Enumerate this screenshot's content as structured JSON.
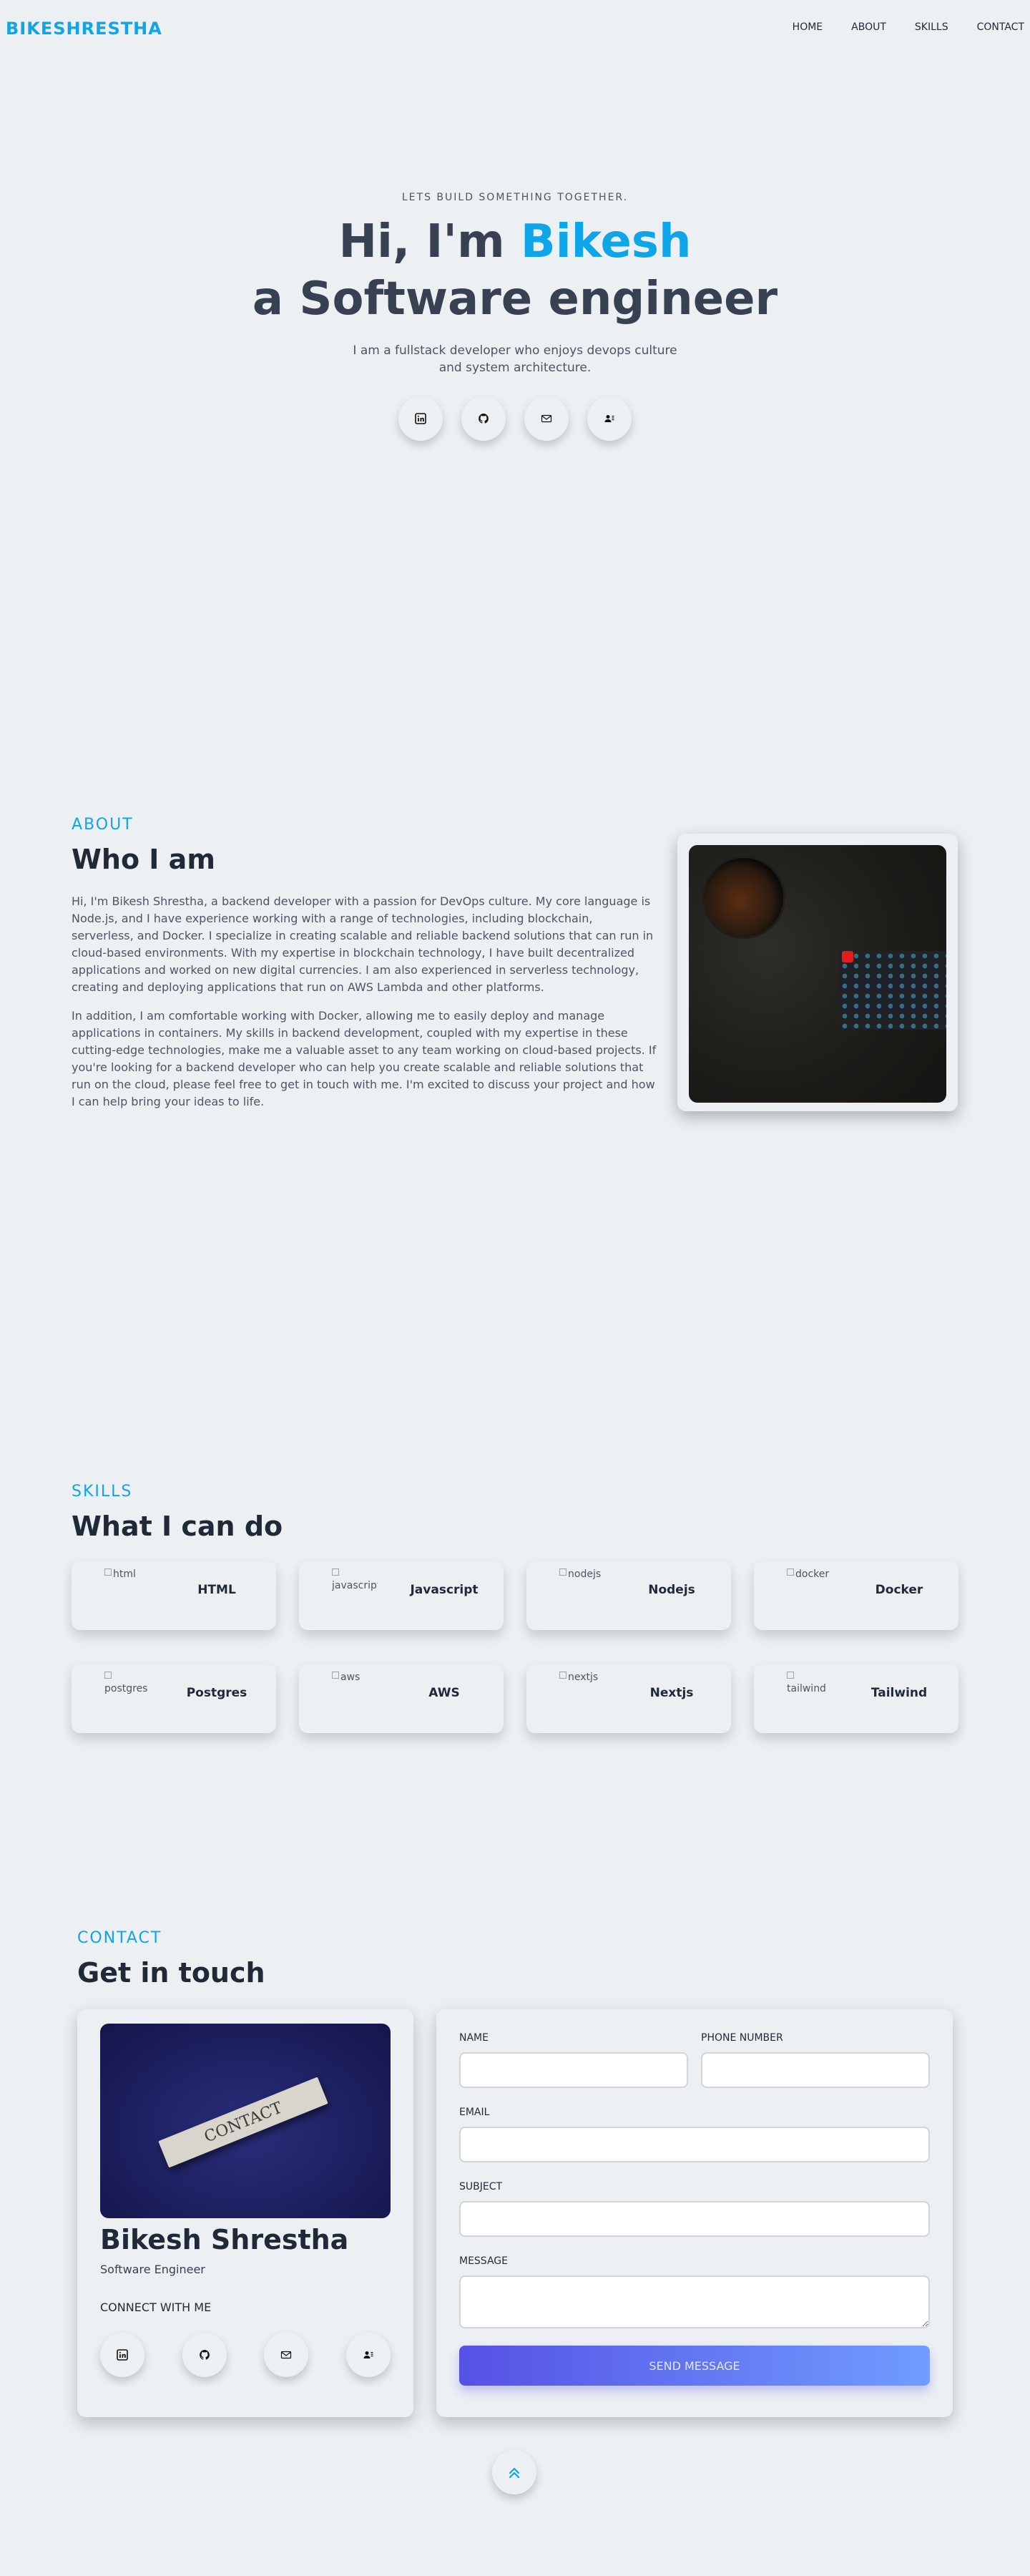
{
  "nav": {
    "logo": "BIKESHRESTHA",
    "links": [
      "HOME",
      "ABOUT",
      "SKILLS",
      "CONTACT"
    ]
  },
  "hero": {
    "kicker": "LETS BUILD SOMETHING TOGETHER.",
    "greeting": "Hi, I'm ",
    "name": "Bikesh",
    "role": "a Software engineer",
    "description": "I am a fullstack developer who enjoys devops culture and system architecture.",
    "socials": [
      "linkedin-icon",
      "github-icon",
      "mail-icon",
      "contact-card-icon"
    ]
  },
  "about": {
    "kicker": "ABOUT",
    "title": "Who I am",
    "paragraphs": [
      "Hi, I'm Bikesh Shrestha, a backend developer with a passion for DevOps culture. My core language is Node.js, and I have experience working with a range of technologies, including blockchain, serverless, and Docker. I specialize in creating scalable and reliable backend solutions that can run in cloud-based environments. With my expertise in blockchain technology, I have built decentralized applications and worked on new digital currencies. I am also experienced in serverless technology, creating and deploying applications that run on AWS Lambda and other platforms.",
      "In addition, I am comfortable working with Docker, allowing me to easily deploy and manage applications in containers. My skills in backend development, coupled with my expertise in these cutting-edge technologies, make me a valuable asset to any team working on cloud-based projects. If you're looking for a backend developer who can help you create scalable and reliable solutions that run on the cloud, please feel free to get in touch with me. I'm excited to discuss your project and how I can help bring your ideas to life."
    ]
  },
  "skills": {
    "kicker": "SKILLS",
    "title": "What I can do",
    "items": [
      {
        "alt": "html",
        "name": "HTML"
      },
      {
        "alt": "javascript",
        "name": "Javascript"
      },
      {
        "alt": "nodejs",
        "name": "Nodejs"
      },
      {
        "alt": "docker",
        "name": "Docker"
      },
      {
        "alt": "postgres",
        "name": "Postgres"
      },
      {
        "alt": "aws",
        "name": "AWS"
      },
      {
        "alt": "nextjs",
        "name": "Nextjs"
      },
      {
        "alt": "tailwind",
        "name": "Tailwind"
      }
    ]
  },
  "contact": {
    "kicker": "CONTACT",
    "title": "Get in touch",
    "photo_text": "CONTACT",
    "name": "Bikesh Shrestha",
    "role": "Software Engineer",
    "connect_label": "CONNECT WITH ME",
    "form": {
      "name_label": "NAME",
      "phone_label": "PHONE NUMBER",
      "email_label": "EMAIL",
      "subject_label": "SUBJECT",
      "message_label": "MESSAGE",
      "name_value": "",
      "phone_value": "",
      "email_value": "",
      "subject_value": "",
      "message_value": "",
      "send_label": "SEND MESSAGE"
    }
  },
  "colors": {
    "accent": "#0ea5e9",
    "background": "#ecf0f3",
    "button_gradient_start": "#5651e5",
    "button_gradient_end": "#709dff"
  }
}
